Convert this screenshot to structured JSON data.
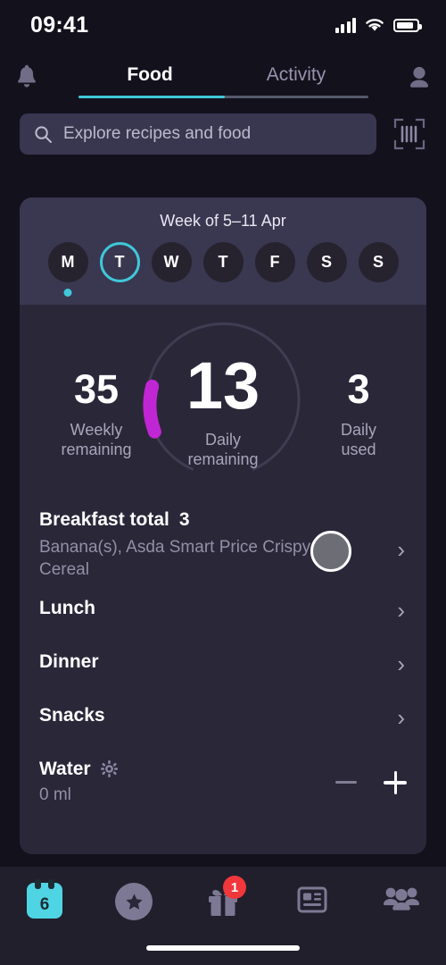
{
  "status_bar": {
    "time": "09:41",
    "signal_icon": "cellular-bars-icon",
    "wifi_icon": "wifi-icon",
    "battery_icon": "battery-icon"
  },
  "header": {
    "notifications_icon": "bell-icon",
    "profile_icon": "user-avatar-icon",
    "tabs": [
      {
        "label": "Food",
        "active": true
      },
      {
        "label": "Activity",
        "active": false
      }
    ],
    "active_accent": "#3fc8d9"
  },
  "search": {
    "placeholder": "Explore recipes and food",
    "value": "",
    "search_icon": "search-icon",
    "barcode_icon": "barcode-scanner-icon"
  },
  "week": {
    "label": "Week of 5–11 Apr",
    "days": [
      {
        "letter": "M",
        "selected": false,
        "dot": true
      },
      {
        "letter": "T",
        "selected": true,
        "dot": false
      },
      {
        "letter": "W",
        "selected": false,
        "dot": false
      },
      {
        "letter": "T",
        "selected": false,
        "dot": false
      },
      {
        "letter": "F",
        "selected": false,
        "dot": false
      },
      {
        "letter": "S",
        "selected": false,
        "dot": false
      },
      {
        "letter": "S",
        "selected": false,
        "dot": false
      }
    ]
  },
  "stats": {
    "weekly_remaining": {
      "value": "35",
      "label_line1": "Weekly",
      "label_line2": "remaining"
    },
    "daily_remaining": {
      "value": "13",
      "label_line1": "Daily",
      "label_line2": "remaining"
    },
    "daily_used": {
      "value": "3",
      "label_line1": "Daily",
      "label_line2": "used"
    },
    "ring_color": "#c026d3",
    "ring_track_color": "#403d53"
  },
  "meals": {
    "breakfast": {
      "title": "Breakfast total",
      "total": "3",
      "items": "Banana(s), Asda Smart Price Crispy Rice Cereal",
      "chevron_icon": "chevron-right-icon"
    },
    "lunch": {
      "title": "Lunch",
      "chevron_icon": "chevron-right-icon"
    },
    "dinner": {
      "title": "Dinner",
      "chevron_icon": "chevron-right-icon"
    },
    "snacks": {
      "title": "Snacks",
      "chevron_icon": "chevron-right-icon"
    },
    "water": {
      "title": "Water",
      "settings_icon": "gear-icon",
      "amount": "0 ml",
      "decrease_icon": "minus-icon",
      "increase_icon": "plus-icon"
    }
  },
  "bottom_nav": [
    {
      "name": "today",
      "icon": "calendar-icon",
      "day_number": "6",
      "active": true,
      "badge": ""
    },
    {
      "name": "favorites",
      "icon": "star-circle-icon",
      "active": false,
      "badge": ""
    },
    {
      "name": "rewards",
      "icon": "gift-icon",
      "active": false,
      "badge": "1"
    },
    {
      "name": "news",
      "icon": "article-icon",
      "active": false,
      "badge": ""
    },
    {
      "name": "community",
      "icon": "people-icon",
      "active": false,
      "badge": ""
    }
  ],
  "badge_color": "#f0373c",
  "home_indicator": "home-indicator"
}
